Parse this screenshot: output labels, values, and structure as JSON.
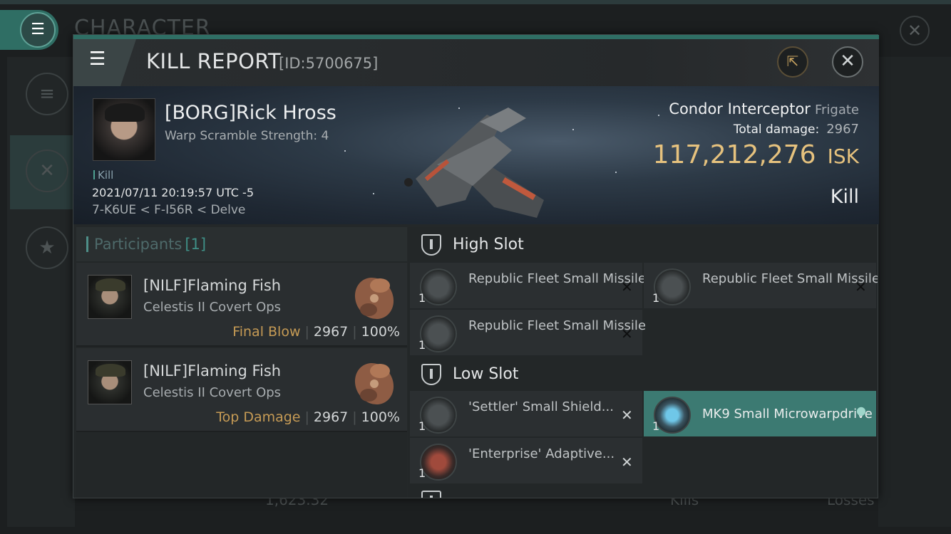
{
  "background": {
    "title": "CHARACTER",
    "close_icon": "✕",
    "menu_icon": "☰",
    "bottom_value": "1,623.32",
    "bottom_kills": "Kills",
    "bottom_losses": "Losses"
  },
  "header": {
    "title": "KILL REPORT",
    "id": "[ID:5700675]"
  },
  "victim": {
    "name": "[BORG]Rick Hross",
    "subtitle": "Warp Scramble Strength: 4",
    "tag": "Kill",
    "datetime": "2021/07/11 20:19:57 UTC -5",
    "location": "7-K6UE < F-I56R < Delve",
    "ship_name": "Condor Interceptor",
    "ship_class": "Frigate",
    "total_damage_label": "Total damage:",
    "total_damage": "2967",
    "isk_value": "117,212,276",
    "isk_unit": "ISK",
    "result": "Kill"
  },
  "participants": {
    "label": "Participants",
    "count": "[1]",
    "rows": [
      {
        "name": "[NILF]Flaming Fish",
        "ship": "Celestis II Covert Ops",
        "role": "Final Blow",
        "damage": "2967",
        "percent": "100%"
      },
      {
        "name": "[NILF]Flaming Fish",
        "ship": "Celestis II Covert Ops",
        "role": "Top Damage",
        "damage": "2967",
        "percent": "100%"
      }
    ]
  },
  "fitting": {
    "high_slot_label": "High Slot",
    "low_slot_label": "Low Slot",
    "high": [
      {
        "name": "Republic Fleet Small Missile ...",
        "qty": "1"
      },
      {
        "name": "Republic Fleet Small Missile ...",
        "qty": "1"
      },
      {
        "name": "Republic Fleet Small Missile ...",
        "qty": "1"
      }
    ],
    "low": [
      {
        "name": "'Settler' Small Shield...",
        "qty": "1"
      },
      {
        "name": "MK9 Small Microwarpdrive",
        "qty": "1"
      },
      {
        "name": "'Enterprise' Adaptive...",
        "qty": "1"
      }
    ]
  }
}
